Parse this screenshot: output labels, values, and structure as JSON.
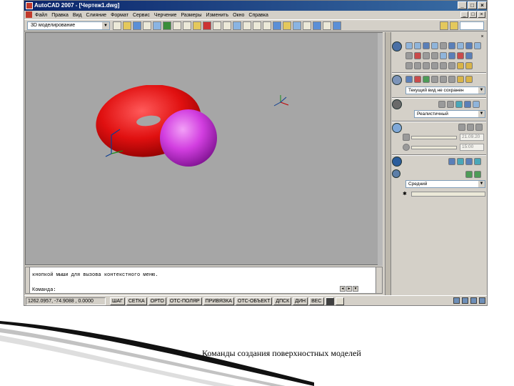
{
  "window": {
    "title": "AutoCAD 2007 - [Чертеж1.dwg]",
    "buttons": [
      "_",
      "□",
      "×"
    ]
  },
  "menu": [
    "Файл",
    "Правка",
    "Вид",
    "Слияние",
    "Формат",
    "Сервис",
    "Черчение",
    "Размеры",
    "Изменить",
    "Окно",
    "Справка"
  ],
  "toolbar": {
    "workspace": "3D моделирование"
  },
  "palette": {
    "view_select": "Текущий вид не сохранен",
    "visual_style": "Реалистичный",
    "date_value": "21.09.20",
    "time_value": "15:00",
    "quality": "Средний"
  },
  "command_line": {
    "line1": "кнопкой мыши для вызова контекстного меню.",
    "prompt": "Команда:"
  },
  "status": {
    "coords": "1262.0957, -74.9088 , 0.0000",
    "buttons": [
      "ШАГ",
      "СЕТКА",
      "ОРТО",
      "ОТС-ПОЛЯР",
      "ПРИВЯЗКА",
      "ОТС-ОБЪЕКТ",
      "ДПСК",
      "ДИН",
      "ВЕС"
    ]
  },
  "caption": "Команды создания поверхностных моделей"
}
